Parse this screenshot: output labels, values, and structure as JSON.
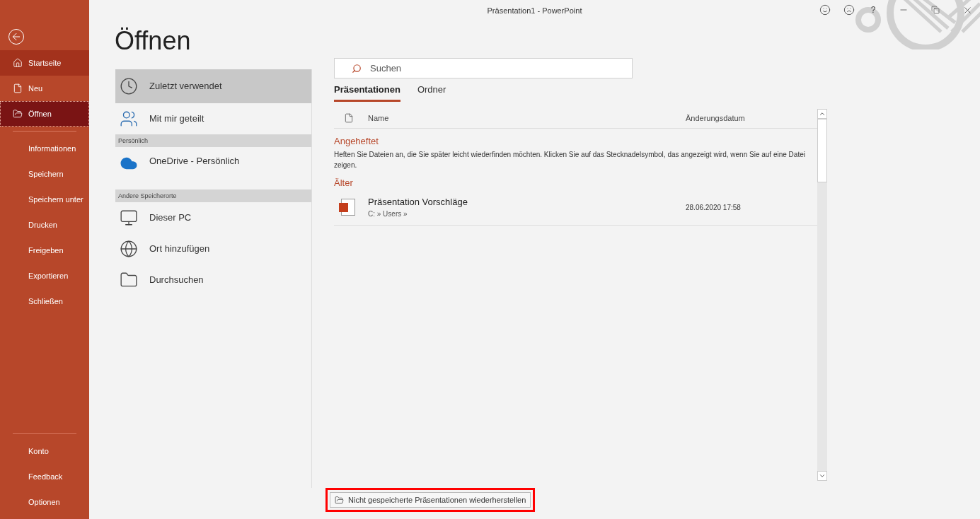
{
  "window": {
    "title": "Präsentation1  -  PowerPoint",
    "help": "?"
  },
  "sidebar": {
    "top": [
      {
        "label": "Startseite",
        "selected": false,
        "hovered": true
      },
      {
        "label": "Neu",
        "selected": false,
        "hovered": false
      },
      {
        "label": "Öffnen",
        "selected": true,
        "hovered": false
      }
    ],
    "middle": [
      {
        "label": "Informationen",
        "selected": false,
        "hovered": false
      },
      {
        "label": "Speichern",
        "selected": false,
        "hovered": false
      },
      {
        "label": "Speichern unter",
        "selected": false,
        "hovered": false
      },
      {
        "label": "Drucken",
        "selected": false,
        "hovered": false
      },
      {
        "label": "Freigeben",
        "selected": false,
        "hovered": false
      },
      {
        "label": "Exportieren",
        "selected": false,
        "hovered": false
      },
      {
        "label": "Schließen",
        "selected": false,
        "hovered": false
      }
    ],
    "bottom": [
      {
        "label": "Konto",
        "selected": false,
        "hovered": false
      },
      {
        "label": "Feedback",
        "selected": false,
        "hovered": false
      },
      {
        "label": "Optionen",
        "selected": false,
        "hovered": false
      }
    ]
  },
  "page_title": "Öffnen",
  "places": [
    {
      "kind": "item",
      "label": "Zuletzt verwendet",
      "selected": true
    },
    {
      "kind": "item",
      "label": "Mit mir geteilt",
      "selected": false
    },
    {
      "kind": "header",
      "label": "Persönlich"
    },
    {
      "kind": "item",
      "label": "OneDrive - Persönlich",
      "selected": false
    },
    {
      "kind": "header",
      "label": "Andere Speicherorte"
    },
    {
      "kind": "item",
      "label": "Dieser PC",
      "selected": false
    },
    {
      "kind": "item",
      "label": "Ort hinzufügen",
      "selected": false
    },
    {
      "kind": "item",
      "label": "Durchsuchen",
      "selected": false
    }
  ],
  "search": {
    "placeholder": "Suchen"
  },
  "tabs": [
    {
      "label": "Präsentationen",
      "selected": true
    },
    {
      "label": "Ordner",
      "selected": false
    }
  ],
  "table": {
    "columns": [
      "Name",
      "Änderungsdatum"
    ],
    "groups": [
      {
        "title": "Angeheftet",
        "note": "Heften Sie Dateien an, die Sie später leicht wiederfinden möchten. Klicken Sie auf das Stecknadelsymbol, das angezeigt wird, wenn Sie auf eine Datei zeigen."
      },
      {
        "title": "Älter",
        "rows": [
          {
            "name": "Präsentation Vorschläge",
            "path": "C: » Users »",
            "date": "28.06.2020 17:58"
          }
        ]
      }
    ]
  },
  "restore_button": {
    "label": "Nicht gespeicherte Präsentationen wiederherstellen",
    "highlighted": true
  }
}
